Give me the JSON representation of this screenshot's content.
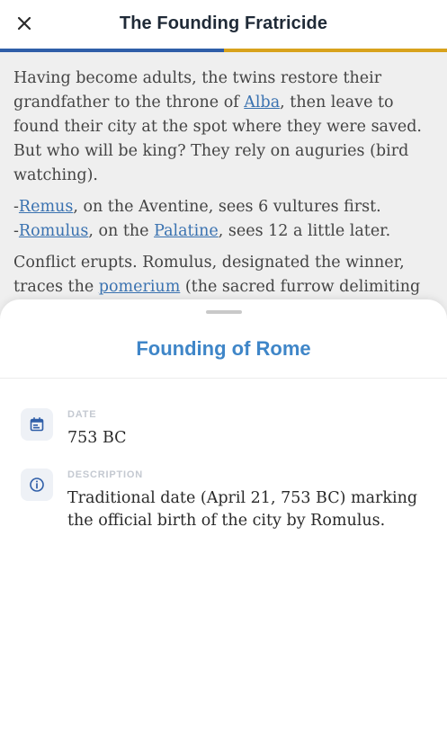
{
  "header": {
    "title": "The Founding Fratricide",
    "close_icon": "close-icon"
  },
  "colors": {
    "progress_done": "#2f5ea8",
    "progress_rest": "#d8a21c",
    "accent": "#3f86c8",
    "link": "#3a72b0"
  },
  "progress": {
    "fraction": 0.5
  },
  "article": {
    "p1": {
      "line1": "Having become adults, the twins restore their",
      "line2_before": "grandfather to the throne of ",
      "line2_link": "Alba",
      "line2_after": ", then leave to",
      "line3": "found their city at the spot where they were saved.",
      "line4": "But who will be king? They rely on auguries (bird",
      "line5": "watching)."
    },
    "p2": {
      "dash1": "-",
      "link1": "Remus",
      "after1": ", on the Aventine, sees 6 vultures first.",
      "dash2": "-",
      "link2": "Romulus",
      "mid2": ", on the ",
      "link3": "Palatine",
      "after2": ", sees 12 a little later."
    },
    "p3": {
      "line1": "Conflict erupts. Romulus, designated the winner,",
      "line2_before": "traces the ",
      "line2_link": "pomerium",
      "line2_after": " (the sacred furrow delimiting"
    }
  },
  "sheet": {
    "title": "Founding of Rome",
    "date": {
      "icon": "calendar-icon",
      "label": "DATE",
      "value": "753 BC"
    },
    "description": {
      "icon": "info-icon",
      "label": "DESCRIPTION",
      "value": "Traditional date (April 21, 753 BC) marking the official birth of the city by Romulus."
    }
  }
}
